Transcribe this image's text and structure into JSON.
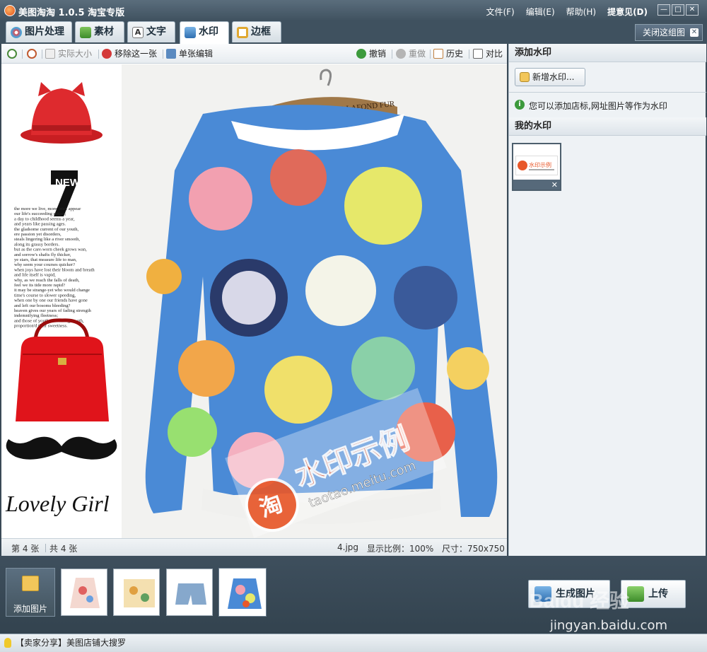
{
  "app": {
    "title": "美图淘淘 1.0.5 淘宝专版"
  },
  "menu": {
    "file": "文件(F)",
    "edit": "编辑(E)",
    "help": "帮助(H)",
    "feedback": "提意见(D)"
  },
  "window_buttons": {
    "minimize": "—",
    "maximize": "□",
    "close": "✕"
  },
  "tabs": [
    {
      "label": "图片处理"
    },
    {
      "label": "素材"
    },
    {
      "label": "文字"
    },
    {
      "label": "水印"
    },
    {
      "label": "边框"
    }
  ],
  "active_tab": "水印",
  "close_group": {
    "label": "关闭这组图"
  },
  "toolbar": {
    "actual_size": "实际大小",
    "remove_one": "移除这一张",
    "single_edit": "单张编辑",
    "undo": "撤销",
    "redo": "重做",
    "history": "历史",
    "compare": "对比"
  },
  "canvas": {
    "brand_text": "CURRURES - BERNARD LAFOND FUR",
    "new_text": "NEW",
    "new_num": "7",
    "poem": [
      "the more we live, more brief appear",
      "our life's succeeding stages;",
      "a day to childhood seems a year,",
      "and years like passing ages.",
      "the gladsome current of our youth,",
      "ere passion yet disorders,",
      "steals lingering like a river smooth,",
      "along its grassy borders.",
      "but as the care-worn cheek grows wan,",
      "and sorrow's shafts fly thicker,",
      "ye stars, that measure life to man,",
      "why seem your courses quicker?",
      "when joys have lost their bloom and breath",
      "and life itself is vapid,",
      "why, as we reach the falls of death,",
      "feel we its tide more rapid?",
      "it may be strange-yet who would change",
      "time's course to slower speeding,",
      "when one by one our friends have gone",
      "and left our bosoms bleeding?",
      "heaven gives our years of fading strength",
      "indemnifying fleetness;",
      "and those of youth, a seeming length,",
      "proportion'd their sweetness."
    ],
    "lovely": "Lovely Girl",
    "watermark_cn": "水印示例",
    "watermark_url": "taotao.meitu.com",
    "watermark_logo_char": "淘"
  },
  "status": {
    "page": "第 4 张",
    "total": "共 4 张",
    "filename": "4.jpg",
    "ratio": "显示比例：100%",
    "size": "尺寸：750x750"
  },
  "right_panel": {
    "add_header": "添加水印",
    "add_button": "新增水印...",
    "info": "您可以添加店标,网址图片等作为水印",
    "my_header": "我的水印",
    "thumb_text": "水印示例",
    "thumb_delete": "✕"
  },
  "bottom": {
    "add_image": "添加图片",
    "generate": "生成图片",
    "upload": "上传"
  },
  "footer": {
    "text": "【卖家分享】美图店铺大搜罗"
  },
  "overlay": {
    "site": "jingyan.baidu.com",
    "logo": "Baidu 经验"
  },
  "colors": {
    "accent": "#3f515f",
    "watermark": "#e8582a"
  }
}
